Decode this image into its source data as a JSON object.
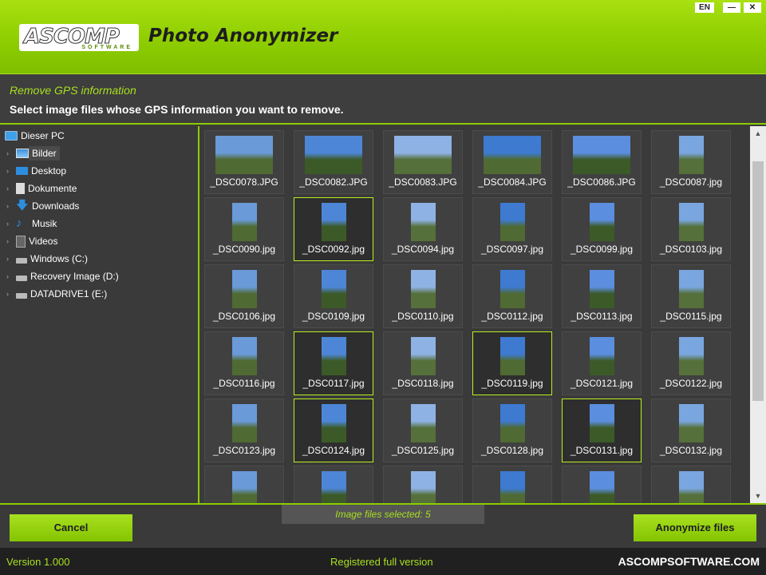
{
  "window": {
    "lang_label": "EN",
    "minimize_label": "—",
    "close_label": "✕"
  },
  "brand": {
    "logo_text": "ASCOMP",
    "logo_sub": "SOFTWARE",
    "app_title": "Photo Anonymizer"
  },
  "step": {
    "title": "Remove GPS information",
    "description": "Select image files whose GPS information you want to remove."
  },
  "tree": {
    "root": "Dieser PC",
    "items": [
      {
        "label": "Bilder",
        "icon": "pictures-folder-icon",
        "selected": true
      },
      {
        "label": "Desktop",
        "icon": "desktop-folder-icon"
      },
      {
        "label": "Dokumente",
        "icon": "documents-folder-icon"
      },
      {
        "label": "Downloads",
        "icon": "downloads-folder-icon"
      },
      {
        "label": "Musik",
        "icon": "music-folder-icon"
      },
      {
        "label": "Videos",
        "icon": "videos-folder-icon"
      },
      {
        "label": "Windows  (C:)",
        "icon": "drive-icon"
      },
      {
        "label": "Recovery Image (D:)",
        "icon": "drive-icon"
      },
      {
        "label": "DATADRIVE1 (E:)",
        "icon": "drive-icon"
      }
    ]
  },
  "files": [
    {
      "name": "_DSC0078.JPG",
      "orientation": "landscape",
      "selected": false
    },
    {
      "name": "_DSC0082.JPG",
      "orientation": "landscape",
      "selected": false
    },
    {
      "name": "_DSC0083.JPG",
      "orientation": "landscape",
      "selected": false
    },
    {
      "name": "_DSC0084.JPG",
      "orientation": "landscape",
      "selected": false
    },
    {
      "name": "_DSC0086.JPG",
      "orientation": "landscape",
      "selected": false
    },
    {
      "name": "_DSC0087.jpg",
      "orientation": "portrait",
      "selected": false
    },
    {
      "name": "_DSC0090.jpg",
      "orientation": "portrait",
      "selected": false
    },
    {
      "name": "_DSC0092.jpg",
      "orientation": "portrait",
      "selected": true
    },
    {
      "name": "_DSC0094.jpg",
      "orientation": "portrait",
      "selected": false
    },
    {
      "name": "_DSC0097.jpg",
      "orientation": "portrait",
      "selected": false
    },
    {
      "name": "_DSC0099.jpg",
      "orientation": "portrait",
      "selected": false
    },
    {
      "name": "_DSC0103.jpg",
      "orientation": "portrait",
      "selected": false
    },
    {
      "name": "_DSC0106.jpg",
      "orientation": "portrait",
      "selected": false
    },
    {
      "name": "_DSC0109.jpg",
      "orientation": "portrait",
      "selected": false
    },
    {
      "name": "_DSC0110.jpg",
      "orientation": "portrait",
      "selected": false
    },
    {
      "name": "_DSC0112.jpg",
      "orientation": "portrait",
      "selected": false
    },
    {
      "name": "_DSC0113.jpg",
      "orientation": "portrait",
      "selected": false
    },
    {
      "name": "_DSC0115.jpg",
      "orientation": "portrait",
      "selected": false
    },
    {
      "name": "_DSC0116.jpg",
      "orientation": "portrait",
      "selected": false
    },
    {
      "name": "_DSC0117.jpg",
      "orientation": "portrait",
      "selected": true
    },
    {
      "name": "_DSC0118.jpg",
      "orientation": "portrait",
      "selected": false
    },
    {
      "name": "_DSC0119.jpg",
      "orientation": "portrait",
      "selected": true
    },
    {
      "name": "_DSC0121.jpg",
      "orientation": "portrait",
      "selected": false
    },
    {
      "name": "_DSC0122.jpg",
      "orientation": "portrait",
      "selected": false
    },
    {
      "name": "_DSC0123.jpg",
      "orientation": "portrait",
      "selected": false
    },
    {
      "name": "_DSC0124.jpg",
      "orientation": "portrait",
      "selected": true
    },
    {
      "name": "_DSC0125.jpg",
      "orientation": "portrait",
      "selected": false
    },
    {
      "name": "_DSC0128.jpg",
      "orientation": "portrait",
      "selected": false
    },
    {
      "name": "_DSC0131.jpg",
      "orientation": "portrait",
      "selected": true
    },
    {
      "name": "_DSC0132.jpg",
      "orientation": "portrait",
      "selected": false
    },
    {
      "name": "",
      "orientation": "portrait",
      "selected": false
    },
    {
      "name": "",
      "orientation": "portrait",
      "selected": false
    },
    {
      "name": "",
      "orientation": "portrait",
      "selected": false
    },
    {
      "name": "",
      "orientation": "portrait",
      "selected": false
    },
    {
      "name": "",
      "orientation": "portrait",
      "selected": false
    },
    {
      "name": "",
      "orientation": "portrait",
      "selected": false
    }
  ],
  "footer": {
    "cancel_label": "Cancel",
    "anonymize_label": "Anonymize files",
    "selected_text": "Image files selected: 5"
  },
  "status": {
    "version": "Version 1.000",
    "registration": "Registered full version",
    "website": "ASCOMPSOFTWARE.COM"
  },
  "colors": {
    "accent": "#8ccc00",
    "accent_text": "#a8e020",
    "panel": "#3a3a3a"
  }
}
